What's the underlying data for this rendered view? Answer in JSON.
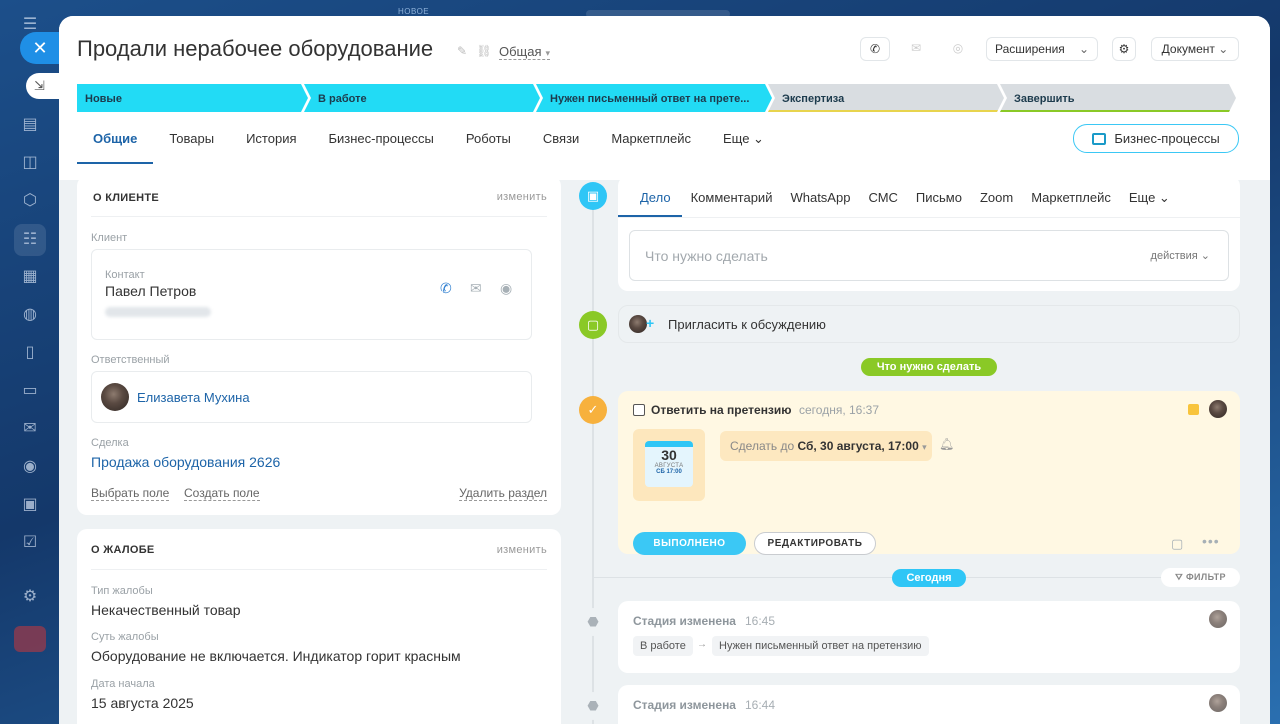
{
  "background": {
    "top_label": "НОВОЕ"
  },
  "rail": {
    "icons": [
      "menu-icon",
      "close-icon",
      "pin-icon",
      "document-icon",
      "chat-icon",
      "hexagon-icon",
      "funnel-icon",
      "calendar-icon",
      "robot-icon",
      "file-icon",
      "card-icon",
      "mail-icon",
      "contacts-icon",
      "id-card-icon",
      "tasks-icon",
      "settings-icon"
    ]
  },
  "header": {
    "title": "Продали нерабочее оборудование",
    "category": "Общая",
    "extensions_label": "Расширения",
    "document_label": "Документ"
  },
  "stages": [
    {
      "label": "Новые",
      "color": "#22dbf5"
    },
    {
      "label": "В работе",
      "color": "#22dbf5"
    },
    {
      "label": "Нужен письменный ответ на прете...",
      "color": "#22dbf5"
    },
    {
      "label": "Экспертиза",
      "color": "#d9dde1"
    },
    {
      "label": "Завершить",
      "color": "#d9dde1"
    }
  ],
  "tabs": [
    "Общие",
    "Товары",
    "История",
    "Бизнес-процессы",
    "Роботы",
    "Связи",
    "Маркетплейс",
    "Еще"
  ],
  "bp_button": "Бизнес-процессы",
  "client": {
    "section_title": "О КЛИЕНТЕ",
    "edit": "изменить",
    "client_label": "Клиент",
    "contact_label": "Контакт",
    "contact_name": "Павел Петров",
    "responsible_label": "Ответственный",
    "responsible_name": "Елизавета Мухина",
    "deal_label": "Сделка",
    "deal_name": "Продажа оборудования 2626",
    "choose_field": "Выбрать поле",
    "create_field": "Создать поле",
    "delete_section": "Удалить раздел"
  },
  "complaint": {
    "section_title": "О ЖАЛОБЕ",
    "edit": "изменить",
    "type_label": "Тип жалобы",
    "type_value": "Некачественный товар",
    "essence_label": "Суть жалобы",
    "essence_value": "Оборудование не включается. Индикатор горит красным",
    "start_label": "Дата начала",
    "start_value": "15 августа 2025"
  },
  "activity_tabs": [
    "Дело",
    "Комментарий",
    "WhatsApp",
    "СМС",
    "Письмо",
    "Zoom",
    "Маркетплейс",
    "Еще"
  ],
  "todo": {
    "placeholder": "Что нужно сделать",
    "actions": "действия"
  },
  "invite": "Пригласить к обсуждению",
  "todo_pill": "Что нужно сделать",
  "task": {
    "title": "Ответить на претензию",
    "time": "сегодня, 16:37",
    "cal_day": "30",
    "cal_month": "АВГУСТА",
    "cal_time": "СБ 17:00",
    "deadline_prefix": "Сделать до",
    "deadline_value": "Сб, 30 августа, 17:00",
    "done_button": "ВЫПОЛНЕНО",
    "edit_button": "РЕДАКТИРОВАТЬ"
  },
  "today_pill": "Сегодня",
  "filter": "ФИЛЬТР",
  "history": [
    {
      "title": "Стадия изменена",
      "time": "16:45",
      "from": "В работе",
      "to": "Нужен письменный ответ на претензию"
    },
    {
      "title": "Стадия изменена",
      "time": "16:44"
    }
  ],
  "colors": {
    "accent": "#1d64a8",
    "stage_active": "#22dbf5",
    "task_bg": "#fff8e3",
    "green": "#8ac926"
  }
}
